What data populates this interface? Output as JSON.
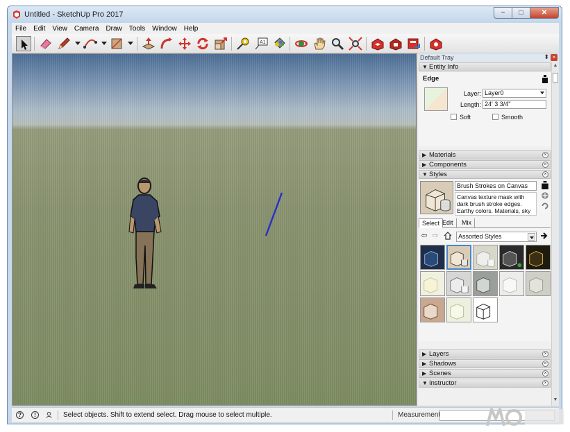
{
  "window": {
    "title": "Untitled - SketchUp Pro 2017",
    "minimize_label": "−",
    "maximize_label": "□",
    "close_label": "✕"
  },
  "menu": [
    "File",
    "Edit",
    "View",
    "Camera",
    "Draw",
    "Tools",
    "Window",
    "Help"
  ],
  "toolbar": {
    "tools": [
      "select-tool",
      "eraser-tool",
      "pencil-tool",
      "arc-tool",
      "rectangle-tool",
      "push-pull-tool",
      "follow-me-tool",
      "move-tool",
      "rotate-tool",
      "scale-tool",
      "tape-measure-tool",
      "text-tool",
      "paint-bucket-tool",
      "orbit-tool",
      "pan-tool",
      "zoom-tool",
      "zoom-extents-tool",
      "3d-warehouse-tool",
      "extension-warehouse-tool",
      "layout-tool",
      "extension-manager-tool"
    ]
  },
  "tray": {
    "title": "Default Tray",
    "pin": "⬍",
    "close": "×",
    "entity_info": {
      "header": "Entity Info",
      "type": "Edge",
      "layer_label": "Layer:",
      "layer_value": "Layer0",
      "length_label": "Length:",
      "length_value": "24' 3 3/4\"",
      "soft_label": "Soft",
      "smooth_label": "Smooth"
    },
    "panels": {
      "materials": "Materials",
      "components": "Components",
      "styles": "Styles",
      "layers": "Layers",
      "shadows": "Shadows",
      "scenes": "Scenes",
      "instructor": "Instructor"
    },
    "styles": {
      "name": "Brush Strokes on Canvas",
      "description": "Canvas texture mask with dark brush stroke edges.  Earthy colors. Materials, sky and",
      "tabs": [
        "Select",
        "Edit",
        "Mix"
      ],
      "collection": "Assorted Styles"
    }
  },
  "status": {
    "message": "Select objects. Shift to extend select. Drag mouse to select multiple.",
    "measurements_label": "Measurements"
  },
  "colors": {
    "edge_line": "#2a2fc8",
    "selection": "#4a86c8",
    "close_button": "#c4442c"
  }
}
